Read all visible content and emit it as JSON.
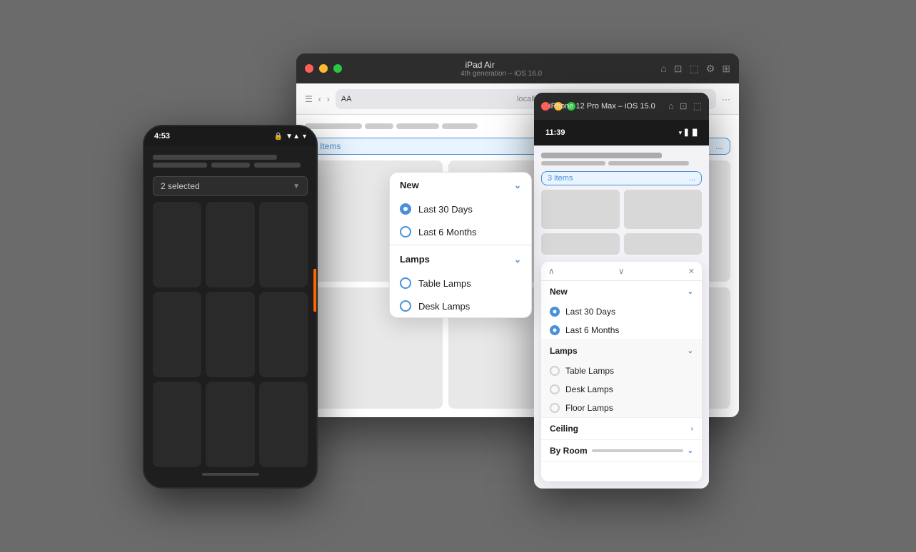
{
  "background": "#6b6b6b",
  "ipad_window": {
    "title": "iPad Air",
    "subtitle": "4th generation – iOS 16.0",
    "address_bar": {
      "aa_label": "AA",
      "url": "localhost"
    },
    "filter_bar": {
      "label": "2 Items",
      "dots": "..."
    },
    "dropdown": {
      "new_section": "New",
      "items": [
        {
          "label": "Last 30 Days",
          "checked": true
        },
        {
          "label": "Last 6 Months",
          "checked": false
        }
      ],
      "lamps_section": "Lamps",
      "lamps_items": [
        {
          "label": "Table Lamps",
          "checked": false
        },
        {
          "label": "Desk Lamps",
          "checked": false
        }
      ]
    }
  },
  "android_phone": {
    "time": "4:53",
    "status_icons": [
      "🔒",
      "□",
      "S",
      "▼",
      "▲",
      "◀"
    ],
    "selected_label": "2 selected",
    "grid_count": 9
  },
  "iphone_window": {
    "title": "iPhone 12 Pro Max – iOS 15.0",
    "time": "11:39",
    "filter_bar": {
      "label": "3 items",
      "dots": "..."
    },
    "popup": {
      "new_section": "New",
      "new_items": [
        {
          "label": "Last 30 Days",
          "checked": true
        },
        {
          "label": "Last 6 Months",
          "checked": true
        }
      ],
      "lamps_section": "Lamps",
      "lamps_items": [
        {
          "label": "Table Lamps",
          "checked": false
        },
        {
          "label": "Desk Lamps",
          "checked": false
        },
        {
          "label": "Floor Lamps",
          "checked": false
        }
      ],
      "ceiling_label": "Ceiling",
      "byroom_label": "By Room"
    }
  }
}
